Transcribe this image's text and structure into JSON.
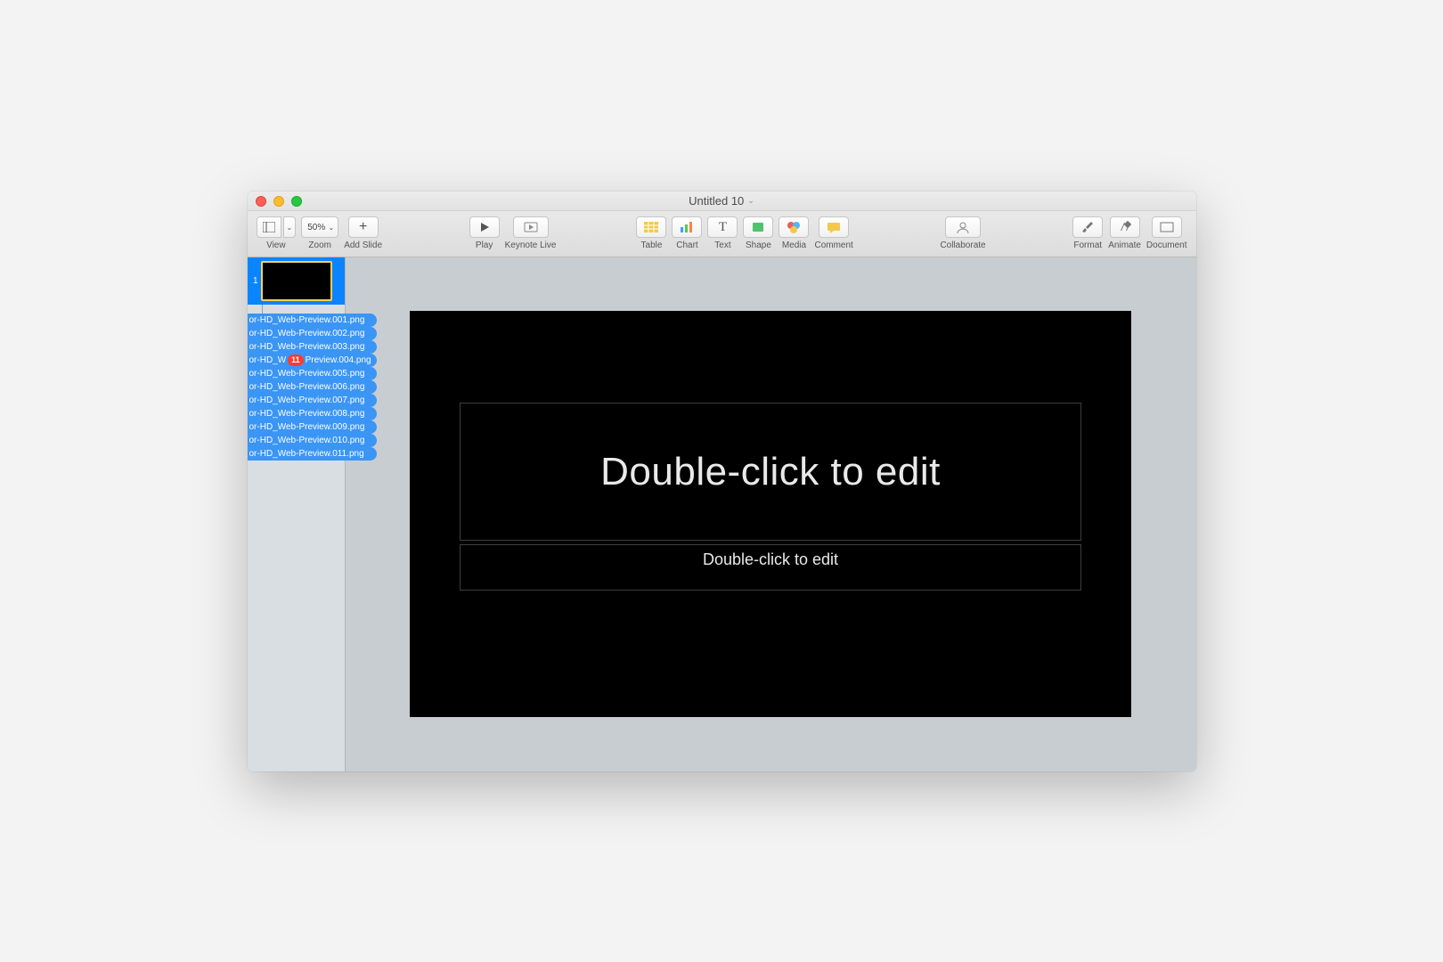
{
  "window": {
    "title": "Untitled 10"
  },
  "toolbar": {
    "view": "View",
    "zoom_label": "Zoom",
    "zoom_value": "50%",
    "add_slide": "Add Slide",
    "play": "Play",
    "keynote_live": "Keynote Live",
    "table": "Table",
    "chart": "Chart",
    "text": "Text",
    "shape": "Shape",
    "media": "Media",
    "comment": "Comment",
    "collaborate": "Collaborate",
    "format": "Format",
    "animate": "Animate",
    "document": "Document"
  },
  "sidebar": {
    "slide_number": "1",
    "drag_badge": "11",
    "drag_items": [
      "or-HD_Web-Preview.001.png",
      "or-HD_Web-Preview.002.png",
      "or-HD_Web-Preview.003.png",
      "or-HD_W|Preview.004.png",
      "or-HD_Web-Preview.005.png",
      "or-HD_Web-Preview.006.png",
      "or-HD_Web-Preview.007.png",
      "or-HD_Web-Preview.008.png",
      "or-HD_Web-Preview.009.png",
      "or-HD_Web-Preview.010.png",
      "or-HD_Web-Preview.011.png"
    ]
  },
  "slide": {
    "title_placeholder": "Double-click to edit",
    "body_placeholder": "Double-click to edit"
  }
}
